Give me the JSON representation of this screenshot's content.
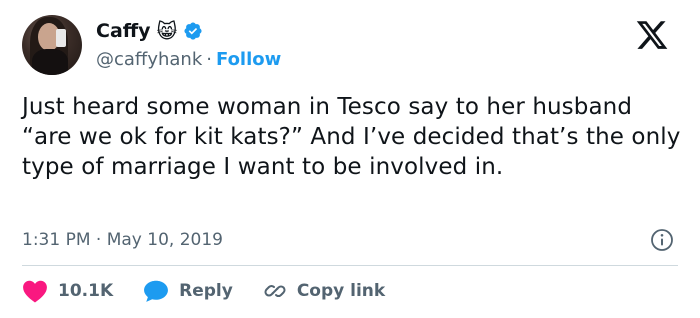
{
  "author": {
    "name": "Caffy",
    "emoji": "😸",
    "handle": "@caffyhank",
    "separator": "·",
    "follow_label": "Follow"
  },
  "tweet": {
    "text": "Just heard some woman in Tesco say to her husband “are we ok for kit kats?” And I’ve decided that’s the only type of marriage I want to be involved in.",
    "timestamp": "1:31 PM · May 10, 2019"
  },
  "actions": {
    "like_count": "10.1K",
    "reply_label": "Reply",
    "copy_link_label": "Copy link"
  },
  "colors": {
    "accent": "#1d9bf0",
    "like": "#f91880",
    "text": "#0f1419",
    "secondary": "#536471"
  },
  "icons": [
    "verified-badge-icon",
    "x-logo-icon",
    "info-icon",
    "heart-icon",
    "reply-bubble-icon",
    "link-icon"
  ]
}
